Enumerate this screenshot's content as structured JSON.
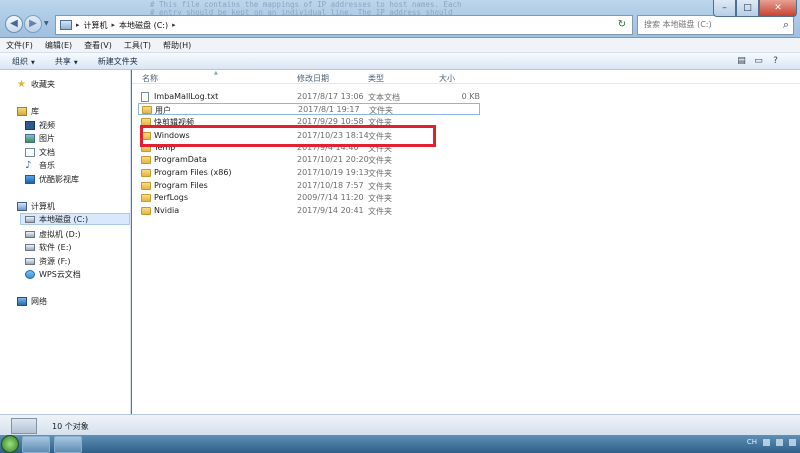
{
  "window": {
    "background_text": "# This file contains the mappings of IP addresses to host names. Each\n# entry should be kept on an individual line. The IP address should\n# be placed in the first column followed by the corresponding host name.\n# The IP address and the host name should be separated by at least one",
    "min_glyph": "–",
    "max_glyph": "□",
    "close_glyph": "✕"
  },
  "address": {
    "crumbs": [
      "计算机",
      "本地磁盘 (C:)"
    ],
    "sep_glyph": "▸"
  },
  "search": {
    "placeholder": "搜索 本地磁盘 (C:)"
  },
  "menu": [
    "文件(F)",
    "编辑(E)",
    "查看(V)",
    "工具(T)",
    "帮助(H)"
  ],
  "toolbar": {
    "organize": "组织",
    "share": "共享",
    "new_folder": "新建文件夹"
  },
  "sidebar": {
    "favorites": "收藏夹",
    "libraries": "库",
    "lib_items": [
      "视频",
      "图片",
      "文档",
      "音乐",
      "优酷影视库"
    ],
    "computer": "计算机",
    "drives": [
      "本地磁盘 (C:)",
      "虚拟机 (D:)",
      "软件 (E:)",
      "资源 (F:)",
      "WPS云文档"
    ],
    "network": "网络"
  },
  "columns": {
    "name": "名称",
    "date": "修改日期",
    "type": "类型",
    "size": "大小"
  },
  "files": [
    {
      "name": "ImbaMallLog.txt",
      "date": "2017/8/17 13:06",
      "type": "文本文档",
      "size": "0 KB",
      "kind": "txt"
    },
    {
      "name": "用户",
      "date": "2017/8/1 19:17",
      "type": "文件夹",
      "size": "",
      "kind": "folder"
    },
    {
      "name": "快剪辑视频",
      "date": "2017/9/29 10:58",
      "type": "文件夹",
      "size": "",
      "kind": "folder"
    },
    {
      "name": "Windows",
      "date": "2017/10/23 18:14",
      "type": "文件夹",
      "size": "",
      "kind": "folder"
    },
    {
      "name": "Temp",
      "date": "2017/9/4 14:40",
      "type": "文件夹",
      "size": "",
      "kind": "folder"
    },
    {
      "name": "ProgramData",
      "date": "2017/10/21 20:20",
      "type": "文件夹",
      "size": "",
      "kind": "folder"
    },
    {
      "name": "Program Files (x86)",
      "date": "2017/10/19 19:13",
      "type": "文件夹",
      "size": "",
      "kind": "folder"
    },
    {
      "name": "Program Files",
      "date": "2017/10/18 7:57",
      "type": "文件夹",
      "size": "",
      "kind": "folder"
    },
    {
      "name": "PerfLogs",
      "date": "2009/7/14 11:20",
      "type": "文件夹",
      "size": "",
      "kind": "folder"
    },
    {
      "name": "Nvidia",
      "date": "2017/9/14 20:41",
      "type": "文件夹",
      "size": "",
      "kind": "folder"
    }
  ],
  "status": {
    "count": "10 个对象"
  },
  "tray": {
    "lang": "CH"
  },
  "colors": {
    "highlight": "#e2202f",
    "accent": "#3a7fb0"
  }
}
